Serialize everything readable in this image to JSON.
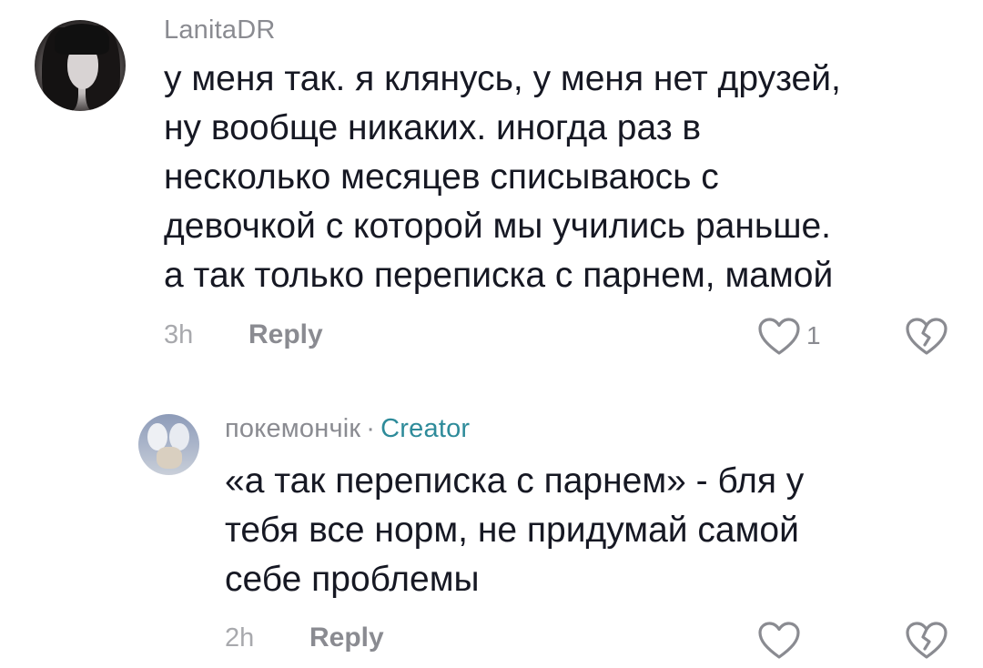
{
  "comments": [
    {
      "username": "LanitaDR",
      "lines": [
        "у меня так. я клянусь, у меня нет друзей,",
        "ну вообще никаких. иногда раз в",
        "несколько месяцев списываюсь с",
        "девочкой с которой мы учились раньше.",
        "а так только переписка с парнем, мамой"
      ],
      "time": "3h",
      "reply_label": "Reply",
      "like_count": "1"
    },
    {
      "username": "покемончік",
      "separator": "·",
      "badge": "Creator",
      "lines": [
        "«а так переписка с парнем» - бля у",
        "тебя все норм, не придумай самой",
        "себе проблемы"
      ],
      "time": "2h",
      "reply_label": "Reply"
    }
  ],
  "icons": {
    "like": "heart-outline-icon",
    "dislike": "broken-heart-icon"
  },
  "colors": {
    "text": "#161823",
    "muted": "#8a8b91",
    "creator": "#2e8b9a"
  }
}
